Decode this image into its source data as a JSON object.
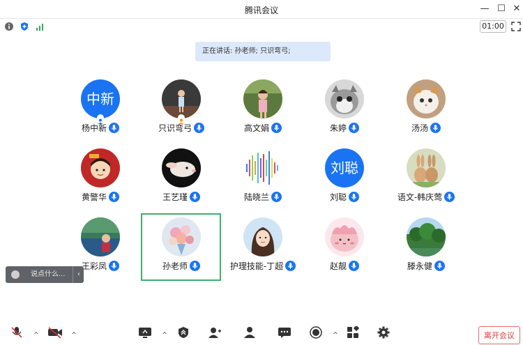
{
  "window": {
    "title": "腾讯会议",
    "controls": [
      "minimize",
      "maximize",
      "close"
    ]
  },
  "topbar": {
    "timer": "01:00",
    "icons": [
      "info-icon",
      "shield-icon",
      "signal-icon"
    ]
  },
  "speaking": {
    "label": "正在讲话: 孙老师; 只识弯弓;"
  },
  "participants": [
    {
      "name": "杨中新",
      "avatar_text": "中新",
      "avatar_type": "text",
      "host": true
    },
    {
      "name": "只识弯弓",
      "avatar_type": "photo",
      "host": true
    },
    {
      "name": "高文娟",
      "avatar_type": "photo"
    },
    {
      "name": "朱婷",
      "avatar_type": "photo"
    },
    {
      "name": "汤汤",
      "avatar_type": "photo"
    },
    {
      "name": "黄警华",
      "avatar_type": "photo"
    },
    {
      "name": "王艺瑾",
      "avatar_type": "photo"
    },
    {
      "name": "陆晓兰",
      "avatar_type": "photo"
    },
    {
      "name": "刘聪",
      "avatar_text": "刘聪",
      "avatar_type": "text"
    },
    {
      "name": "语文-韩庆莺",
      "avatar_type": "photo"
    },
    {
      "name": "王彩凤",
      "avatar_type": "photo"
    },
    {
      "name": "孙老师",
      "avatar_type": "photo",
      "active_speaker": true
    },
    {
      "name": "护理技能-丁超",
      "avatar_type": "photo"
    },
    {
      "name": "赵靓",
      "avatar_type": "photo"
    },
    {
      "name": "滕永健",
      "avatar_type": "photo"
    }
  ],
  "chat": {
    "placeholder": "说点什么..."
  },
  "bottombar": {
    "icons": [
      "mic-muted-icon",
      "camera-off-icon",
      "share-screen-icon",
      "security-icon",
      "invite-icon",
      "members-icon",
      "chat-icon",
      "record-icon",
      "apps-icon",
      "settings-icon"
    ],
    "leave_label": "离开会议"
  },
  "colors": {
    "accent": "#1a73f2",
    "active_border": "#3bb06b",
    "leave": "#d93b3b",
    "speaking_bg": "#dce9fb"
  }
}
